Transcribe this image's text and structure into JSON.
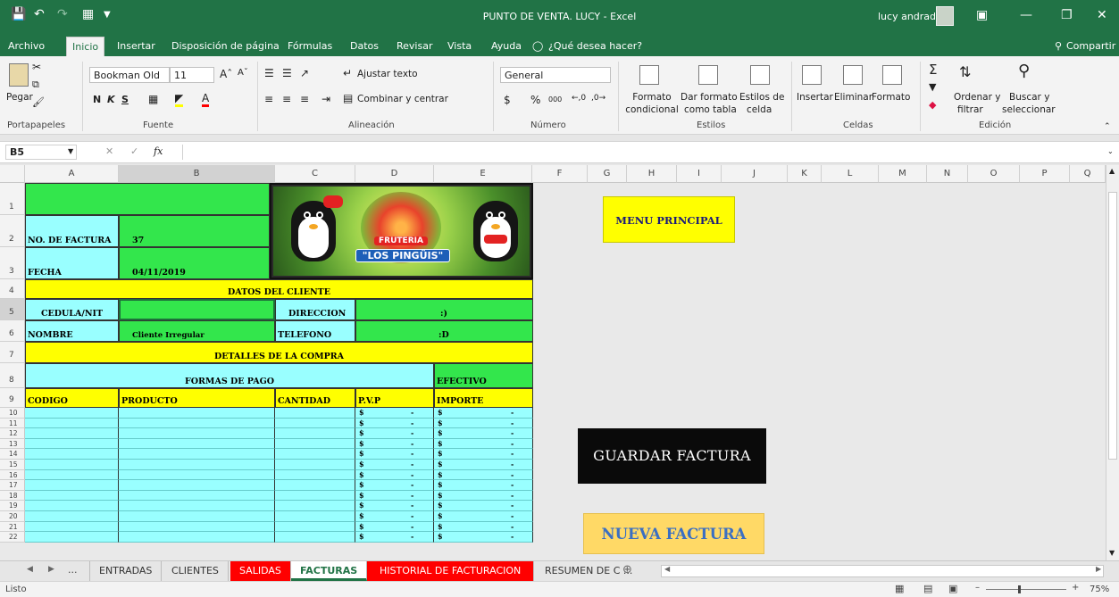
{
  "app": {
    "window_title": "PUNTO DE VENTA. LUCY  -  Excel",
    "user_name": "lucy andrade"
  },
  "menu": [
    "Archivo",
    "Inicio",
    "Insertar",
    "Disposición de página",
    "Fórmulas",
    "Datos",
    "Revisar",
    "Vista",
    "Ayuda"
  ],
  "tell_me": "¿Qué desea hacer?",
  "share": "Compartir",
  "ribbon": {
    "paste": "Pegar",
    "clipboard": "Portapapeles",
    "font_name": "Bookman Old",
    "font_size": "11",
    "bold": "N",
    "italic": "K",
    "underline": "S",
    "font_group": "Fuente",
    "wrap_text": "Ajustar texto",
    "merge_center": "Combinar y centrar",
    "alignment_group": "Alineación",
    "number_format": "General",
    "currency": "$",
    "percent": "%",
    "thousands": "000",
    "number_group": "Número",
    "cond_format": [
      "Formato",
      "condicional"
    ],
    "table_format": [
      "Dar formato",
      "como tabla"
    ],
    "cell_styles": [
      "Estilos de",
      "celda"
    ],
    "styles_group": "Estilos",
    "insert": "Insertar",
    "delete": "Eliminar",
    "format": "Formato",
    "cells_group": "Celdas",
    "sort_filter": [
      "Ordenar y",
      "filtrar"
    ],
    "find_select": [
      "Buscar y",
      "seleccionar"
    ],
    "editing_group": "Edición"
  },
  "formula_bar": {
    "name_box": "B5",
    "fx": "fx",
    "value": ""
  },
  "columns": [
    "A",
    "B",
    "C",
    "D",
    "E",
    "F",
    "G",
    "H",
    "I",
    "J",
    "K",
    "L",
    "M",
    "N",
    "O",
    "P",
    "Q"
  ],
  "rows": [
    "1",
    "2",
    "3",
    "4",
    "5",
    "6",
    "7",
    "8",
    "9",
    "10",
    "11",
    "12",
    "13",
    "14",
    "15",
    "16",
    "17",
    "18",
    "19",
    "20",
    "21",
    "22"
  ],
  "invoice": {
    "no_label": "NO. DE FACTURA",
    "no_value": "37",
    "date_label": "FECHA",
    "date_value": "04/11/2019",
    "client_header": "DATOS DEL CLIENTE",
    "cedula_label": "CEDULA/NIT",
    "cedula_value": "",
    "direccion_label": "DIRECCION",
    "direccion_value": ":)",
    "nombre_label": "NOMBRE",
    "nombre_value": "Cliente Irregular",
    "telefono_label": "TELEFONO",
    "telefono_value": ":D",
    "purchase_header": "DETALLES DE LA COMPRA",
    "payment_label": "FORMAS DE PAGO",
    "payment_value": "EFECTIVO",
    "col_codigo": "CODIGO",
    "col_producto": "PRODUCTO",
    "col_cantidad": "CANTIDAD",
    "col_pvp": "P.V.P",
    "col_importe": "IMPORTE",
    "currency_symbol": "$",
    "dash": "-"
  },
  "logo": {
    "line1": "FRUTERIA",
    "line2": "\"LOS PINGÜIS\""
  },
  "buttons": {
    "menu": "MENU PRINCIPAL",
    "save": "GUARDAR FACTURA",
    "new": "NUEVA FACTURA"
  },
  "tabs": [
    "ENTRADAS",
    "CLIENTES",
    "SALIDAS",
    "FACTURAS",
    "HISTORIAL DE FACTURACION",
    "RESUMEN DE C ..."
  ],
  "tabs_more": "...",
  "status": {
    "ready": "Listo",
    "zoom": "75%"
  },
  "colors": {
    "excel_green": "#217346",
    "cell_green": "#33e64c",
    "cell_cyan": "#99ffff",
    "cell_yellow": "#ffff00"
  }
}
